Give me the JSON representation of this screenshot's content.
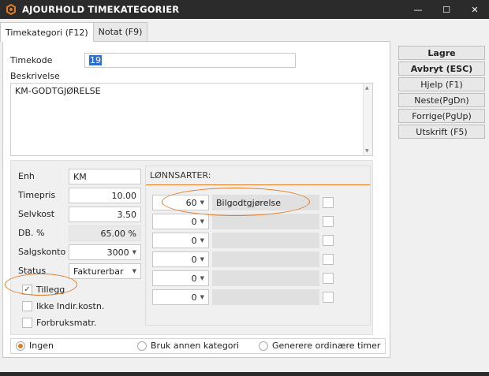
{
  "window": {
    "title": "AJOURHOLD TIMEKATEGORIER",
    "controls": {
      "minimize": "—",
      "maximize": "☐",
      "close": "✕"
    }
  },
  "tabs": [
    {
      "label": "Timekategori (F12)",
      "active": true
    },
    {
      "label": "Notat (F9)",
      "active": false
    }
  ],
  "form": {
    "timekode_label": "Timekode",
    "timekode_value": "19",
    "beskrivelse_label": "Beskrivelse",
    "beskrivelse_value": "KM-GODTGJØRELSE",
    "enh_label": "Enh",
    "enh_value": "KM",
    "timepris_label": "Timepris",
    "timepris_value": "10.00",
    "selvkost_label": "Selvkost",
    "selvkost_value": "3.50",
    "db_label": "DB. %",
    "db_value": "65.00 %",
    "salgskonto_label": "Salgskonto",
    "salgskonto_value": "3000",
    "status_label": "Status",
    "status_value": "Fakturerbar"
  },
  "checkboxes": [
    {
      "label": "Tillegg",
      "checked": true
    },
    {
      "label": "Ikke Indir.kostn.",
      "checked": false
    },
    {
      "label": "Forbruksmatr.",
      "checked": false
    }
  ],
  "lonnsarter": {
    "title": "LØNNSARTER:",
    "rows": [
      {
        "code": "60",
        "name": "Bilgodtgjørelse"
      },
      {
        "code": "0",
        "name": ""
      },
      {
        "code": "0",
        "name": ""
      },
      {
        "code": "0",
        "name": ""
      },
      {
        "code": "0",
        "name": ""
      },
      {
        "code": "0",
        "name": ""
      }
    ]
  },
  "radios": [
    {
      "label": "Ingen",
      "selected": true
    },
    {
      "label": "Bruk annen kategori",
      "selected": false
    },
    {
      "label": "Generere ordinære timer",
      "selected": false
    }
  ],
  "buttons": {
    "lagre": "Lagre",
    "avbryt": "Avbryt (ESC)",
    "hjelp": "Hjelp (F1)",
    "neste": "Neste(PgDn)",
    "forrige": "Forrige(PgUp)",
    "utskrift": "Utskrift (F5)"
  },
  "colors": {
    "accent": "#e07a25",
    "titlebar": "#2b2b2b"
  },
  "icons": {
    "dropdown": "▼",
    "check": "✓"
  }
}
